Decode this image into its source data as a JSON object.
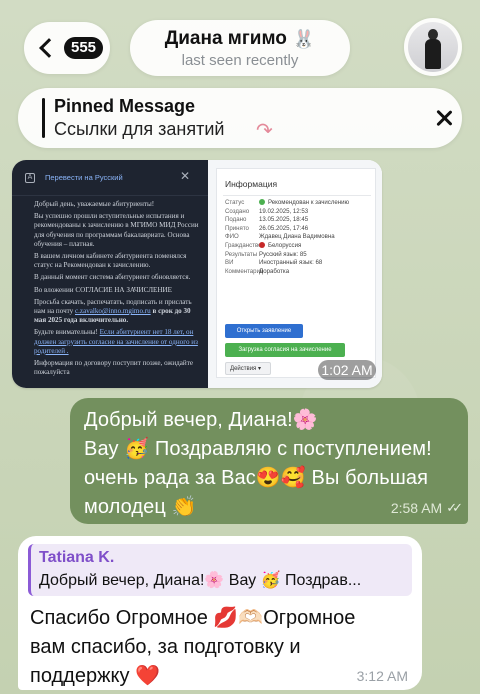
{
  "header": {
    "unread_count": "555",
    "chat_name": "Диана мгимо",
    "chat_name_emoji": "🐰",
    "status": "last seen recently"
  },
  "pinned": {
    "title": "Pinned Message",
    "text": "Ссылки для занятий",
    "arrow_glyph": "↷"
  },
  "image_message": {
    "time": "1:02 AM",
    "translate_label": "Перевести на Русский",
    "email_paragraphs": [
      "Добрый день, уважаемые абитуриенты!",
      "Вы успешно прошли вступительные испытания и рекомендованы к зачислению в МГИМО МИД России для обучения по программам бакалавриата. Основа обучения – платная.",
      "В вашем личном кабинете абитуриента поменялся статус на Рекомендован к зачислению.",
      "В данный момент система абитуриент обновляется.",
      "Во вложении СОГЛАСИЕ НА ЗАЧИСЛЕНИЕ",
      "Просьба скачать, распечатать, подписать и прислать нам на почту",
      "c.zavalko@inno.mgimo.ru",
      "в срок до 30 мая 2025 года включительно.",
      "Будьте внимательны!",
      "Если абитуриент нет 18 лет, он должен загрузить согласие на зачисление от одного из родителей .",
      "Информация по договору поступит позже, ожидайте пожалуйста"
    ],
    "info": {
      "title": "Информация",
      "rows": [
        {
          "k": "Статус",
          "v": "Рекомендован к зачислению"
        },
        {
          "k": "Создано",
          "v": "19.02.2025, 12:53"
        },
        {
          "k": "Подано",
          "v": "13.05.2025, 18:45"
        },
        {
          "k": "Принято",
          "v": "26.05.2025, 17:46"
        },
        {
          "k": "ФИО",
          "v": "Ждавец Диана Вадимовна"
        },
        {
          "k": "Гражданство",
          "v": "Белоруссия"
        },
        {
          "k": "Результаты",
          "v": "Русский язык: 85"
        },
        {
          "k": "ВИ",
          "v": "Иностранный язык: 68"
        },
        {
          "k": "Комментарий",
          "v": "Доработка"
        }
      ],
      "btn_open": "Открыть заявление",
      "btn_upload": "Загрузка согласия на зачисление",
      "btn_actions": "Действия ▾"
    }
  },
  "outgoing_message": {
    "lines": [
      "Добрый вечер, Диана!🌸",
      "Вау 🥳 Поздравляю с поступлением!",
      "очень рада за Вас😍🥰 Вы большая",
      "молодец 👏"
    ],
    "time": "2:58 AM",
    "checks": "✓✓"
  },
  "incoming_message": {
    "quote_author": "Tatiana K.",
    "quote_text": "Добрый вечер, Диана!🌸 Вау 🥳 Поздрав...",
    "lines": [
      "Спасибо Огромное 💋🫶🏻Огромное",
      "вам спасибо, за подготовку и",
      "поддержку ❤️"
    ],
    "time": "3:12 AM"
  },
  "colors": {
    "outgoing_bubble": "#73905e",
    "quote_accent": "#8b5bd6",
    "status_green": "#4cb050",
    "primary_blue": "#2f6fd0"
  }
}
